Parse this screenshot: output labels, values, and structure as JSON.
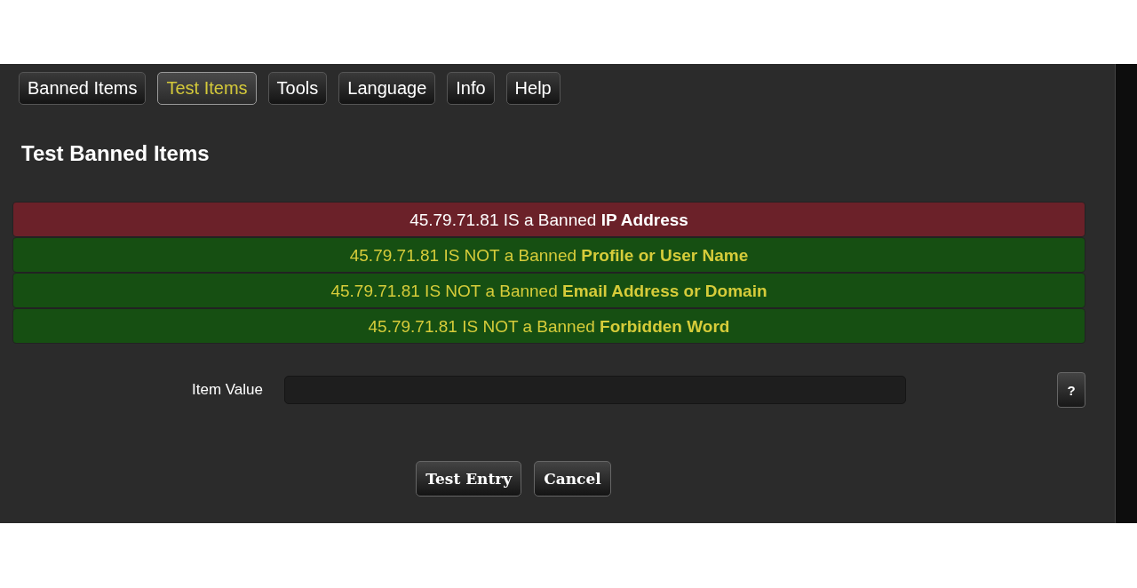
{
  "tabs": [
    {
      "label": "Banned Items",
      "selected": false
    },
    {
      "label": "Test Items",
      "selected": true
    },
    {
      "label": "Tools",
      "selected": false
    },
    {
      "label": "Language",
      "selected": false
    },
    {
      "label": "Info",
      "selected": false
    },
    {
      "label": "Help",
      "selected": false
    }
  ],
  "heading": "Test Banned Items",
  "results": [
    {
      "kind": "banned",
      "text": "45.79.71.81 IS a Banned **IP Address**"
    },
    {
      "kind": "not_banned",
      "text": "45.79.71.81 IS NOT a Banned **Profile or User Name**"
    },
    {
      "kind": "not_banned",
      "text": "45.79.71.81 IS NOT a Banned **Email Address or Domain**"
    },
    {
      "kind": "not_banned",
      "text": "45.79.71.81 IS NOT a Banned **Forbidden Word**"
    }
  ],
  "form": {
    "label": "Item Value",
    "help": "?"
  },
  "buttons": [
    "Test Entry",
    "Cancel"
  ]
}
